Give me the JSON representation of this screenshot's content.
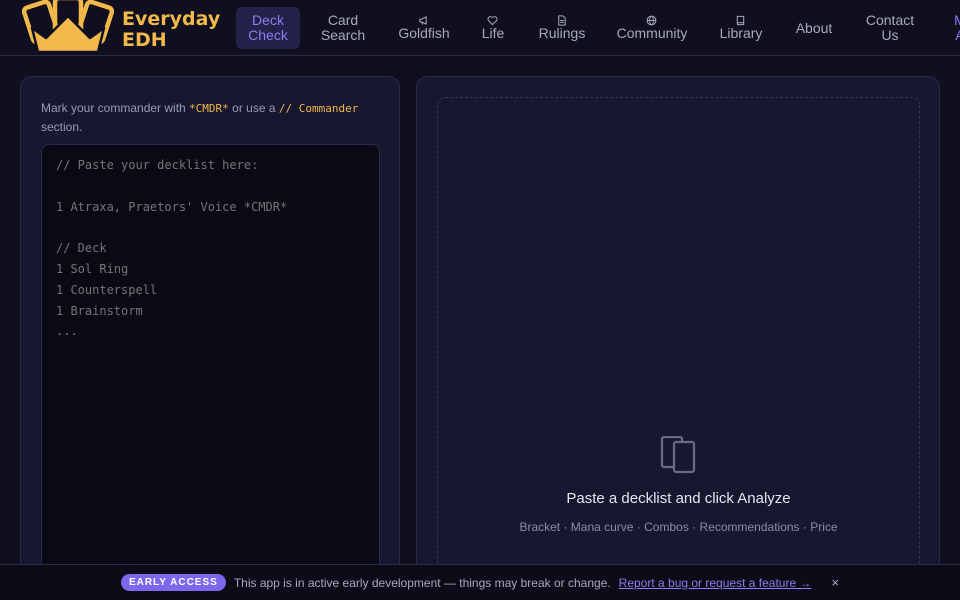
{
  "app": {
    "brand_line1": "Everyday",
    "brand_line2": "EDH",
    "brand_color": "#f2b84b",
    "accent_color": "#7b68ee"
  },
  "nav": {
    "items": [
      {
        "line1": "Deck",
        "line2": "Check",
        "icon": "",
        "active": true
      },
      {
        "line1": "Card",
        "line2": "Search",
        "icon": "",
        "active": false
      },
      {
        "line1": "",
        "line2": "Goldfish",
        "icon": "megaphone-icon",
        "active": false
      },
      {
        "line1": "",
        "line2": "Life",
        "icon": "heart-icon",
        "active": false
      },
      {
        "line1": "",
        "line2": "Rulings",
        "icon": "document-icon",
        "active": false
      },
      {
        "line1": "",
        "line2": "Community",
        "icon": "globe-icon",
        "active": false
      },
      {
        "line1": "",
        "line2": "Library",
        "icon": "book-icon",
        "active": false
      },
      {
        "line1": "About",
        "line2": "",
        "icon": "",
        "active": false
      },
      {
        "line1": "Contact",
        "line2": "Us",
        "icon": "",
        "active": false
      },
      {
        "line1": "M",
        "line2": "A",
        "icon": "",
        "active": false
      }
    ]
  },
  "input_panel": {
    "hint_before": "Mark your commander with",
    "hint_cmdr_tag": "*CMDR*",
    "hint_middle": "or use a",
    "hint_section_tag": "// Commander",
    "hint_after": "section.",
    "placeholder": "// Paste your decklist here:\n\n1 Atraxa, Praetors' Voice *CMDR*\n\n// Deck\n1 Sol Ring\n1 Counterspell\n1 Brainstorm\n..."
  },
  "results_panel": {
    "empty_icon": "cards-icon",
    "empty_title": "Paste a decklist and click Analyze",
    "empty_subtitle": "Bracket · Mana curve · Combos · Recommendations · Price"
  },
  "banner": {
    "badge": "EARLY ACCESS",
    "message": "This app is in active early development — things may break or change.",
    "link": "Report a bug or request a feature →",
    "close": "×"
  }
}
